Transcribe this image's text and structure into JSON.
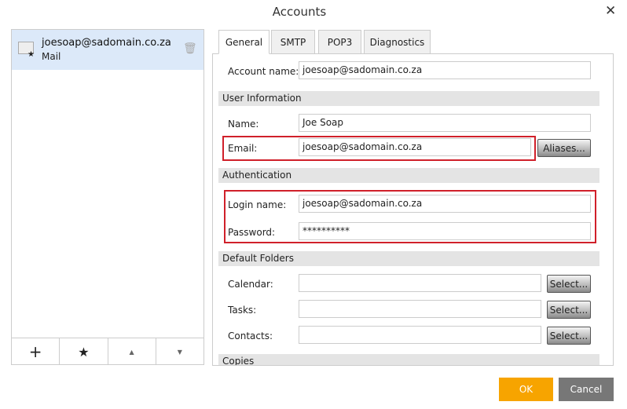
{
  "title": "Accounts",
  "accounts": [
    {
      "email": "joesoap@sadomain.co.za",
      "type": "Mail"
    }
  ],
  "toolbar": {
    "add": "+",
    "default": "★",
    "up": "▲",
    "down": "▼"
  },
  "tabs": [
    "General",
    "SMTP",
    "POP3",
    "Diagnostics"
  ],
  "general": {
    "account_name_label": "Account name:",
    "account_name": "joesoap@sadomain.co.za",
    "user_info": "User Information",
    "name_label": "Name:",
    "name": "Joe Soap",
    "email_label": "Email:",
    "email": "joesoap@sadomain.co.za",
    "aliases": "Aliases...",
    "auth": "Authentication",
    "login_label": "Login name:",
    "login": "joesoap@sadomain.co.za",
    "password_label": "Password:",
    "password": "**********",
    "folders": "Default Folders",
    "calendar_label": "Calendar:",
    "tasks_label": "Tasks:",
    "contacts_label": "Contacts:",
    "select": "Select...",
    "copies": "Copies"
  },
  "ok": "OK",
  "cancel": "Cancel"
}
